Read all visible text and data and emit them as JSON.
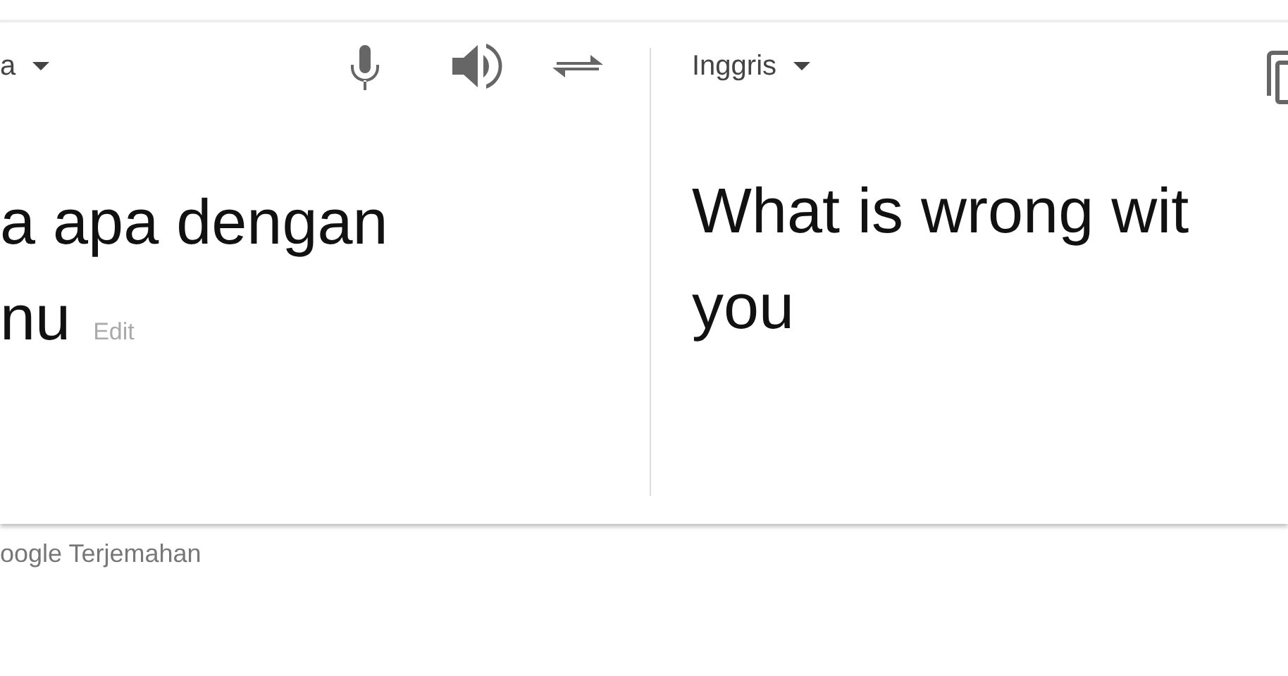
{
  "source": {
    "language": "a",
    "text_lines": [
      "a apa dengan",
      "nu"
    ],
    "edit_link": "Edit"
  },
  "target": {
    "language": "Inggris",
    "text_lines": [
      "What is wrong wit",
      "you"
    ]
  },
  "footer": "oogle Terjemahan"
}
